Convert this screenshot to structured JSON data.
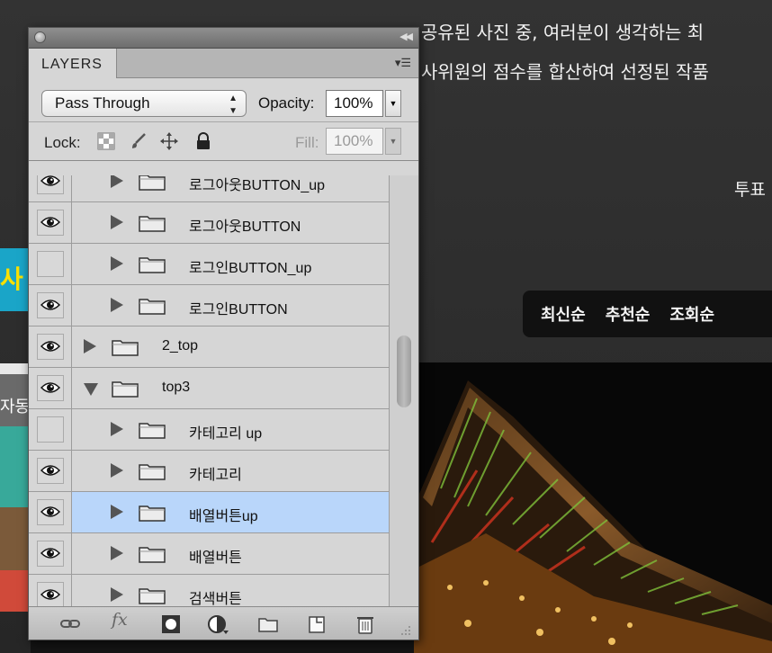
{
  "background": {
    "text_line1": "공유된 사진 중, 여러분이 생각하는 최",
    "text_line2": "사위원의 점수를 합산하여 선정된 작품",
    "vote_label": "투표",
    "cyan_text": "사",
    "strip_text": "자동",
    "sort_tabs": [
      "최신순",
      "추천순",
      "조회순"
    ]
  },
  "panel": {
    "collapse_icon": "double-chevron-icon",
    "tab_label": "LAYERS",
    "menu_icon": "panel-menu-icon",
    "blend_mode": "Pass Through",
    "opacity_label": "Opacity:",
    "opacity_value": "100%",
    "lock_label": "Lock:",
    "fill_label": "Fill:",
    "fill_value": "100%",
    "layers": [
      {
        "name": "로그아웃BUTTON_up",
        "visible": true,
        "depth": 1,
        "expanded": false,
        "selected": false
      },
      {
        "name": "로그아웃BUTTON",
        "visible": true,
        "depth": 1,
        "expanded": false,
        "selected": false
      },
      {
        "name": "로그인BUTTON_up",
        "visible": false,
        "depth": 1,
        "expanded": false,
        "selected": false
      },
      {
        "name": "로그인BUTTON",
        "visible": true,
        "depth": 1,
        "expanded": false,
        "selected": false
      },
      {
        "name": "2_top",
        "visible": true,
        "depth": 0,
        "expanded": false,
        "selected": false
      },
      {
        "name": "top3",
        "visible": true,
        "depth": 0,
        "expanded": true,
        "selected": false
      },
      {
        "name": "카테고리 up",
        "visible": false,
        "depth": 1,
        "expanded": false,
        "selected": false
      },
      {
        "name": "카테고리",
        "visible": true,
        "depth": 1,
        "expanded": false,
        "selected": false
      },
      {
        "name": "배열버튼up",
        "visible": true,
        "depth": 1,
        "expanded": false,
        "selected": true
      },
      {
        "name": "배열버튼",
        "visible": true,
        "depth": 1,
        "expanded": false,
        "selected": false
      },
      {
        "name": "검색버튼",
        "visible": true,
        "depth": 1,
        "expanded": false,
        "selected": false
      }
    ],
    "bottom_icons": [
      "link-layers-icon",
      "fx-icon",
      "layer-mask-icon",
      "adjustment-layer-icon",
      "new-group-icon",
      "new-layer-icon",
      "trash-icon"
    ],
    "fx_label": "fx"
  }
}
